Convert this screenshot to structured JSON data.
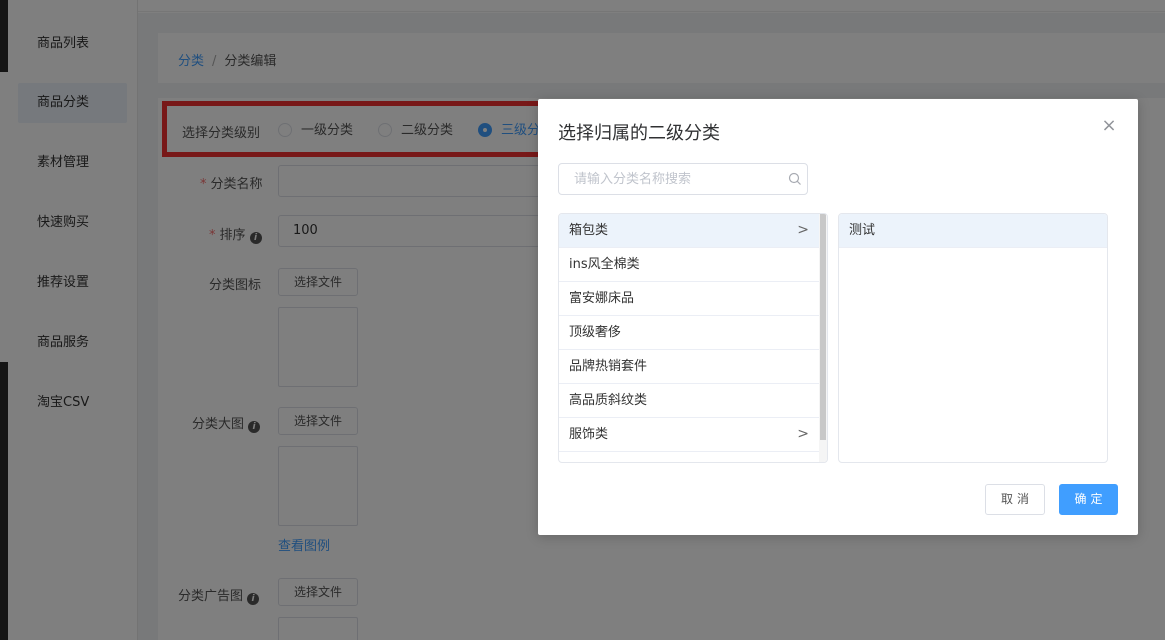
{
  "sidebar": {
    "items": [
      {
        "label": "商品列表",
        "active": false
      },
      {
        "label": "商品分类",
        "active": true
      },
      {
        "label": "素材管理",
        "active": false
      },
      {
        "label": "快速购买",
        "active": false
      },
      {
        "label": "推荐设置",
        "active": false
      },
      {
        "label": "商品服务",
        "active": false
      },
      {
        "label": "淘宝CSV",
        "active": false
      }
    ]
  },
  "breadcrumb": {
    "root": "分类",
    "separator": "/",
    "current": "分类编辑"
  },
  "form": {
    "level_label": "选择分类级别",
    "level_options": [
      {
        "label": "一级分类",
        "checked": false
      },
      {
        "label": "二级分类",
        "checked": false
      },
      {
        "label": "三级分",
        "checked": true
      }
    ],
    "name_label": "分类名称",
    "name_value": "",
    "sort_label": "排序",
    "sort_value": "100",
    "icon_label": "分类图标",
    "big_image_label": "分类大图",
    "ad_image_label": "分类广告图",
    "choose_file_label": "选择文件",
    "view_example_label": "查看图例"
  },
  "dialog": {
    "title": "选择归属的二级分类",
    "close_glyph": "×",
    "search_placeholder": "请输入分类名称搜索",
    "left_list": [
      {
        "label": "箱包类",
        "has_children": true,
        "selected": true
      },
      {
        "label": "ins风全棉类",
        "has_children": false,
        "selected": false
      },
      {
        "label": "富安娜床品",
        "has_children": false,
        "selected": false
      },
      {
        "label": "顶级奢侈",
        "has_children": false,
        "selected": false
      },
      {
        "label": "品牌热销套件",
        "has_children": false,
        "selected": false
      },
      {
        "label": "高品质斜纹类",
        "has_children": false,
        "selected": false
      },
      {
        "label": "服饰类",
        "has_children": true,
        "selected": false
      }
    ],
    "right_list": [
      {
        "label": "测试",
        "selected": true
      }
    ],
    "chevron_glyph": ">",
    "cancel_label": "取消",
    "confirm_label": "确定"
  },
  "colors": {
    "accent": "#409eff",
    "highlight": "#f03030",
    "required": "#f56c6c",
    "selected_row": "#ecf3fb"
  },
  "icons": {
    "search": "search-icon",
    "close": "close-icon",
    "chevron": "chevron-right-icon",
    "info": "info-icon"
  }
}
